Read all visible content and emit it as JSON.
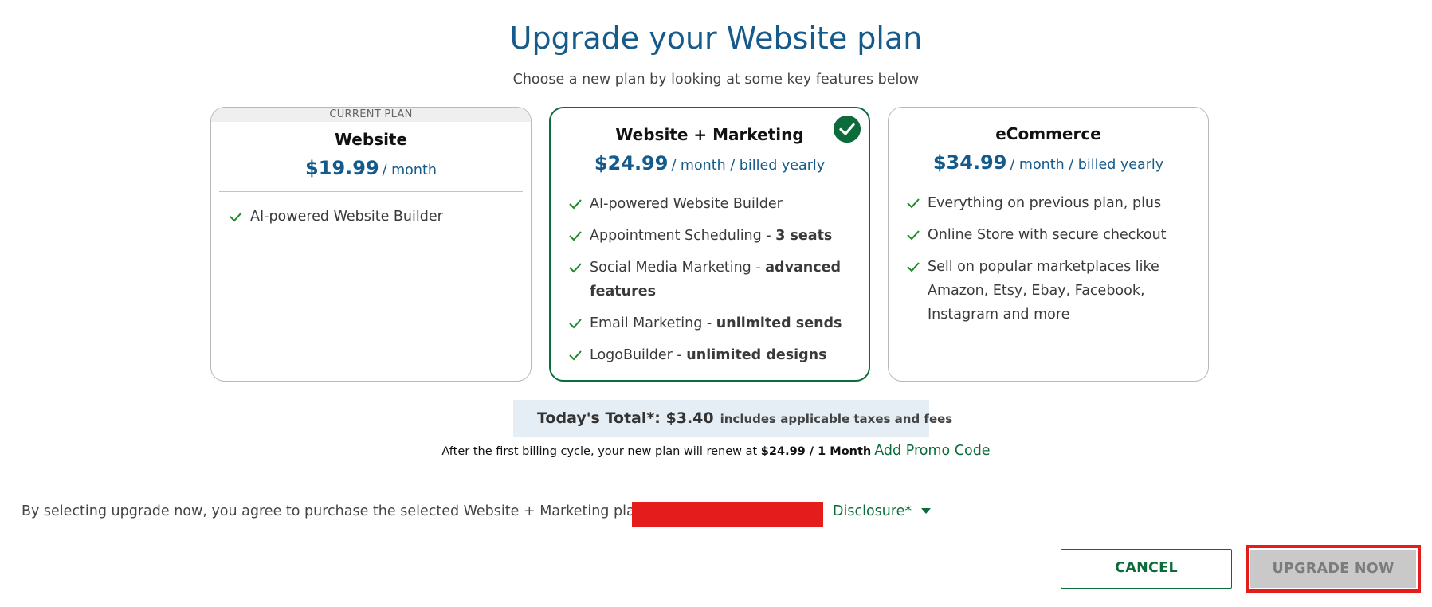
{
  "header": {
    "title": "Upgrade your Website plan",
    "subtitle": "Choose a new plan by looking at some key features below"
  },
  "plans": [
    {
      "badge": "CURRENT PLAN",
      "name": "Website",
      "price": "$19.99",
      "period": "/ month",
      "features": [
        {
          "text": "AI-powered Website Builder",
          "bold": ""
        }
      ]
    },
    {
      "name": "Website + Marketing",
      "price": "$24.99",
      "period": "/ month / billed yearly",
      "selected": true,
      "features": [
        {
          "text": "AI-powered Website Builder",
          "bold": ""
        },
        {
          "text": "Appointment Scheduling - ",
          "bold": "3 seats"
        },
        {
          "text": "Social Media Marketing - ",
          "bold": "advanced features"
        },
        {
          "text": "Email Marketing - ",
          "bold": "unlimited sends"
        },
        {
          "text": "LogoBuilder - ",
          "bold": "unlimited designs"
        }
      ]
    },
    {
      "name": "eCommerce",
      "price": "$34.99",
      "period": "/ month / billed yearly",
      "features": [
        {
          "text": "Everything on previous plan, plus",
          "bold": ""
        },
        {
          "text": "Online Store with secure checkout",
          "bold": ""
        },
        {
          "text": "Sell on popular marketplaces like Amazon, Etsy, Ebay, Facebook, Instagram and more",
          "bold": ""
        }
      ]
    }
  ],
  "total": {
    "label": "Today's Total*: $3.40",
    "note": "includes applicable taxes and fees"
  },
  "renewal": {
    "text": "After the first billing cycle, your new plan will renew at",
    "amount": "$24.99 / 1 Month",
    "promo_link": "Add Promo Code"
  },
  "agreement": {
    "text": "By selecting upgrade now, you agree to purchase the selected Website + Marketing plan with",
    "disclosure": "Disclosure*"
  },
  "actions": {
    "cancel": "CANCEL",
    "upgrade": "UPGRADE NOW"
  },
  "colors": {
    "brand_blue": "#145b8b",
    "brand_green": "#0c6b3b",
    "check_green": "#1d8a2a",
    "highlight_red": "#e51c1c",
    "total_bg": "#e5eef4",
    "disabled_btn": "#c9c9c9"
  },
  "icons": {
    "feature": "checkmark-icon",
    "selected": "check-circle-icon",
    "disclosure": "caret-down-icon"
  }
}
